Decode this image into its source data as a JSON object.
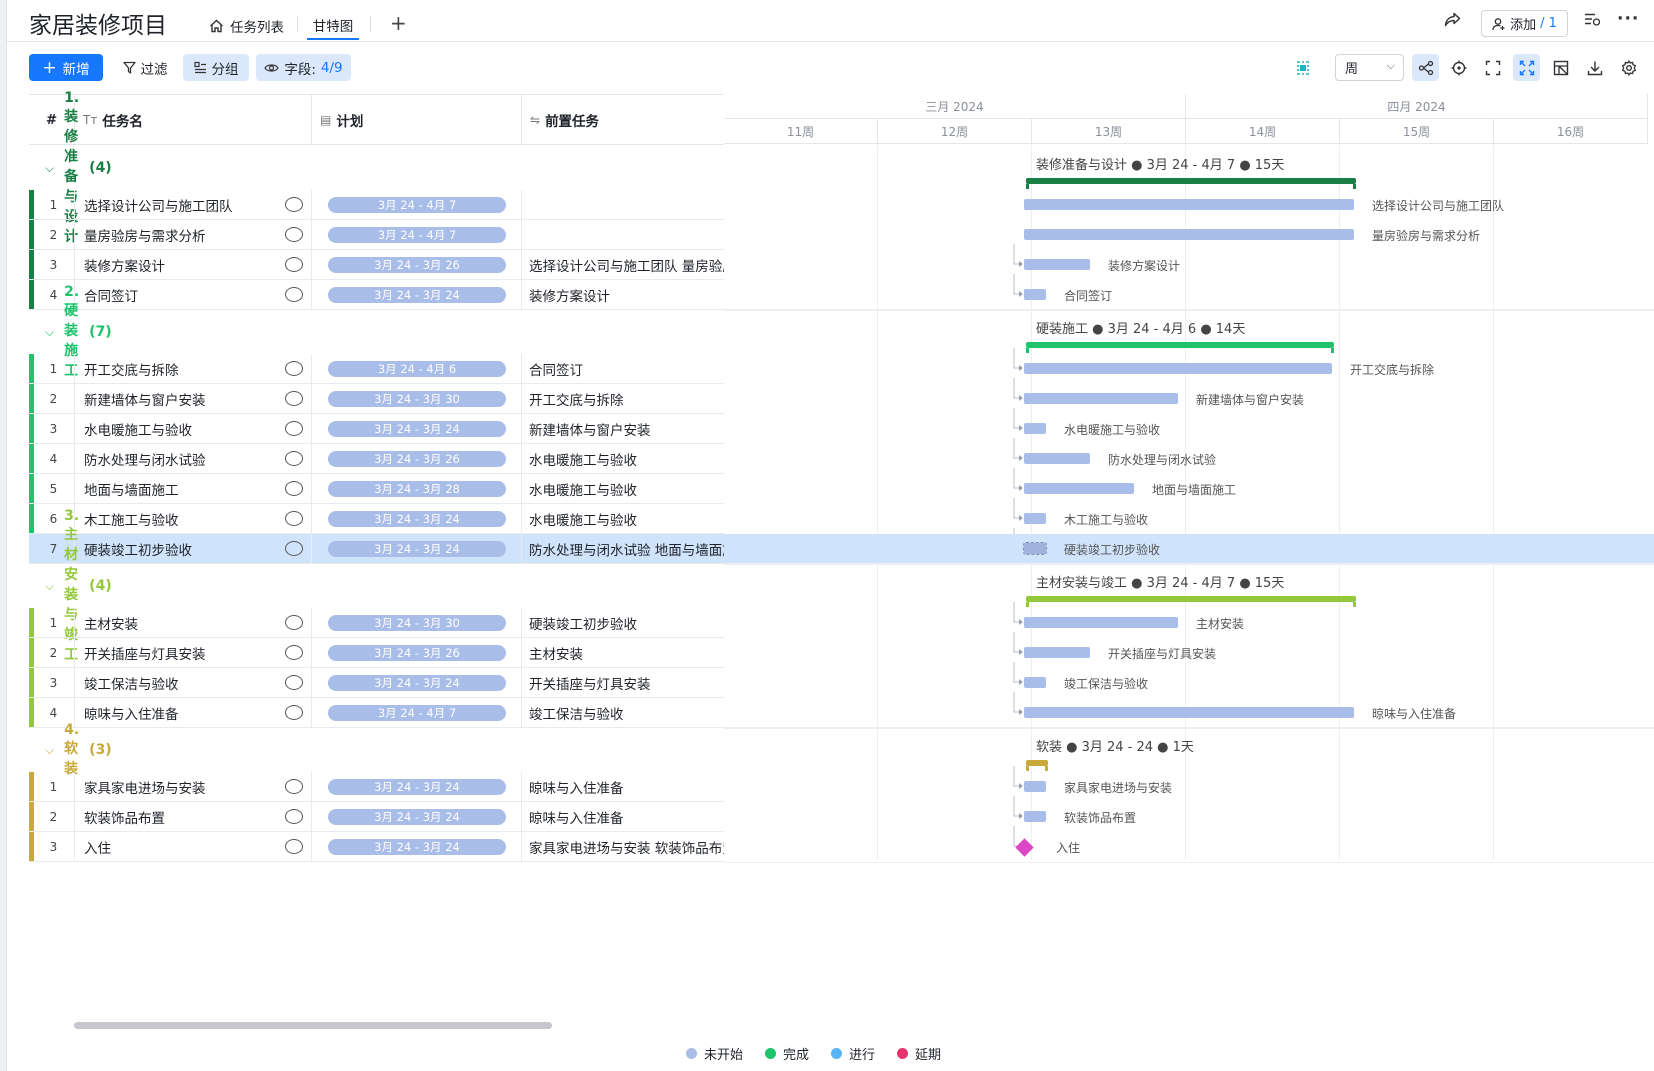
{
  "app_title": "家居装修项目",
  "tabs": [
    {
      "label": "任务列表",
      "icon": "home-icon"
    },
    {
      "label": "甘特图",
      "icon": ""
    }
  ],
  "header": {
    "add_label": "添加",
    "add_count": "/ 1"
  },
  "toolbar": {
    "new_label": "新增",
    "filter_label": "过滤",
    "group_label": "分组",
    "fields_label": "字段:",
    "fields_count": "4/9",
    "period": "周"
  },
  "columns": {
    "no": "#",
    "name": "任务名",
    "plan": "计划",
    "pre": "前置任务"
  },
  "gantt_header": {
    "months": [
      "三月 2024",
      "四月 2024"
    ],
    "weeks": [
      "11周",
      "12周",
      "13周",
      "14周",
      "15周",
      "16周"
    ]
  },
  "groups": [
    {
      "title": "1. 装修准备与设计",
      "count": "(4)",
      "color": "#1a7f45",
      "summary": "装修准备与设计 ● 3月 24 - 4月 7 ● 15天",
      "tasks": [
        {
          "no": "1",
          "name": "选择设计公司与施工团队",
          "plan": "3月 24 - 4月 7",
          "pre": ""
        },
        {
          "no": "2",
          "name": "量房验房与需求分析",
          "plan": "3月 24 - 4月 7",
          "pre": ""
        },
        {
          "no": "3",
          "name": "装修方案设计",
          "plan": "3月 24 - 3月 26",
          "pre": "选择设计公司与施工团队  量房验房与需求分析"
        },
        {
          "no": "4",
          "name": "合同签订",
          "plan": "3月 24 - 3月 24",
          "pre": "装修方案设计"
        }
      ]
    },
    {
      "title": "2. 硬装施工",
      "count": "(7)",
      "color": "#1ec36b",
      "summary": "硬装施工 ● 3月 24 - 4月 6 ● 14天",
      "tasks": [
        {
          "no": "1",
          "name": "开工交底与拆除",
          "plan": "3月 24 - 4月 6",
          "pre": "合同签订"
        },
        {
          "no": "2",
          "name": "新建墙体与窗户安装",
          "plan": "3月 24 - 3月 30",
          "pre": "开工交底与拆除"
        },
        {
          "no": "3",
          "name": "水电暖施工与验收",
          "plan": "3月 24 - 3月 24",
          "pre": "新建墙体与窗户安装"
        },
        {
          "no": "4",
          "name": "防水处理与闭水试验",
          "plan": "3月 24 - 3月 26",
          "pre": "水电暖施工与验收"
        },
        {
          "no": "5",
          "name": "地面与墙面施工",
          "plan": "3月 24 - 3月 28",
          "pre": "水电暖施工与验收"
        },
        {
          "no": "6",
          "name": "木工施工与验收",
          "plan": "3月 24 - 3月 24",
          "pre": "水电暖施工与验收"
        },
        {
          "no": "7",
          "name": "硬装竣工初步验收",
          "plan": "3月 24 - 3月 24",
          "pre": "防水处理与闭水试验  地面与墙面施工  木工施工与验收"
        }
      ]
    },
    {
      "title": "3. 主材安装与竣工",
      "count": "(4)",
      "color": "#93c83a",
      "summary": "主材安装与竣工 ● 3月 24 - 4月 7 ● 15天",
      "tasks": [
        {
          "no": "1",
          "name": "主材安装",
          "plan": "3月 24 - 3月 30",
          "pre": "硬装竣工初步验收"
        },
        {
          "no": "2",
          "name": "开关插座与灯具安装",
          "plan": "3月 24 - 3月 26",
          "pre": "主材安装"
        },
        {
          "no": "3",
          "name": "竣工保洁与验收",
          "plan": "3月 24 - 3月 24",
          "pre": "开关插座与灯具安装"
        },
        {
          "no": "4",
          "name": "晾味与入住准备",
          "plan": "3月 24 - 4月 7",
          "pre": "竣工保洁与验收"
        }
      ]
    },
    {
      "title": "4. 软装",
      "count": "(3)",
      "color": "#c8a93a",
      "summary": "软装 ● 3月 24 - 24 ● 1天",
      "tasks": [
        {
          "no": "1",
          "name": "家具家电进场与安装",
          "plan": "3月 24 - 3月 24",
          "pre": "晾味与入住准备"
        },
        {
          "no": "2",
          "name": "软装饰品布置",
          "plan": "3月 24 - 3月 24",
          "pre": "晾味与入住准备"
        },
        {
          "no": "3",
          "name": "入住",
          "plan": "3月 24 - 3月 24",
          "pre": "家具家电进场与安装  软装饰品布置"
        }
      ]
    }
  ],
  "legend": [
    {
      "label": "未开始",
      "color": "#a8bde8"
    },
    {
      "label": "完成",
      "color": "#1ec36b"
    },
    {
      "label": "进行",
      "color": "#5ab4f5"
    },
    {
      "label": "延期",
      "color": "#e8336d"
    }
  ]
}
